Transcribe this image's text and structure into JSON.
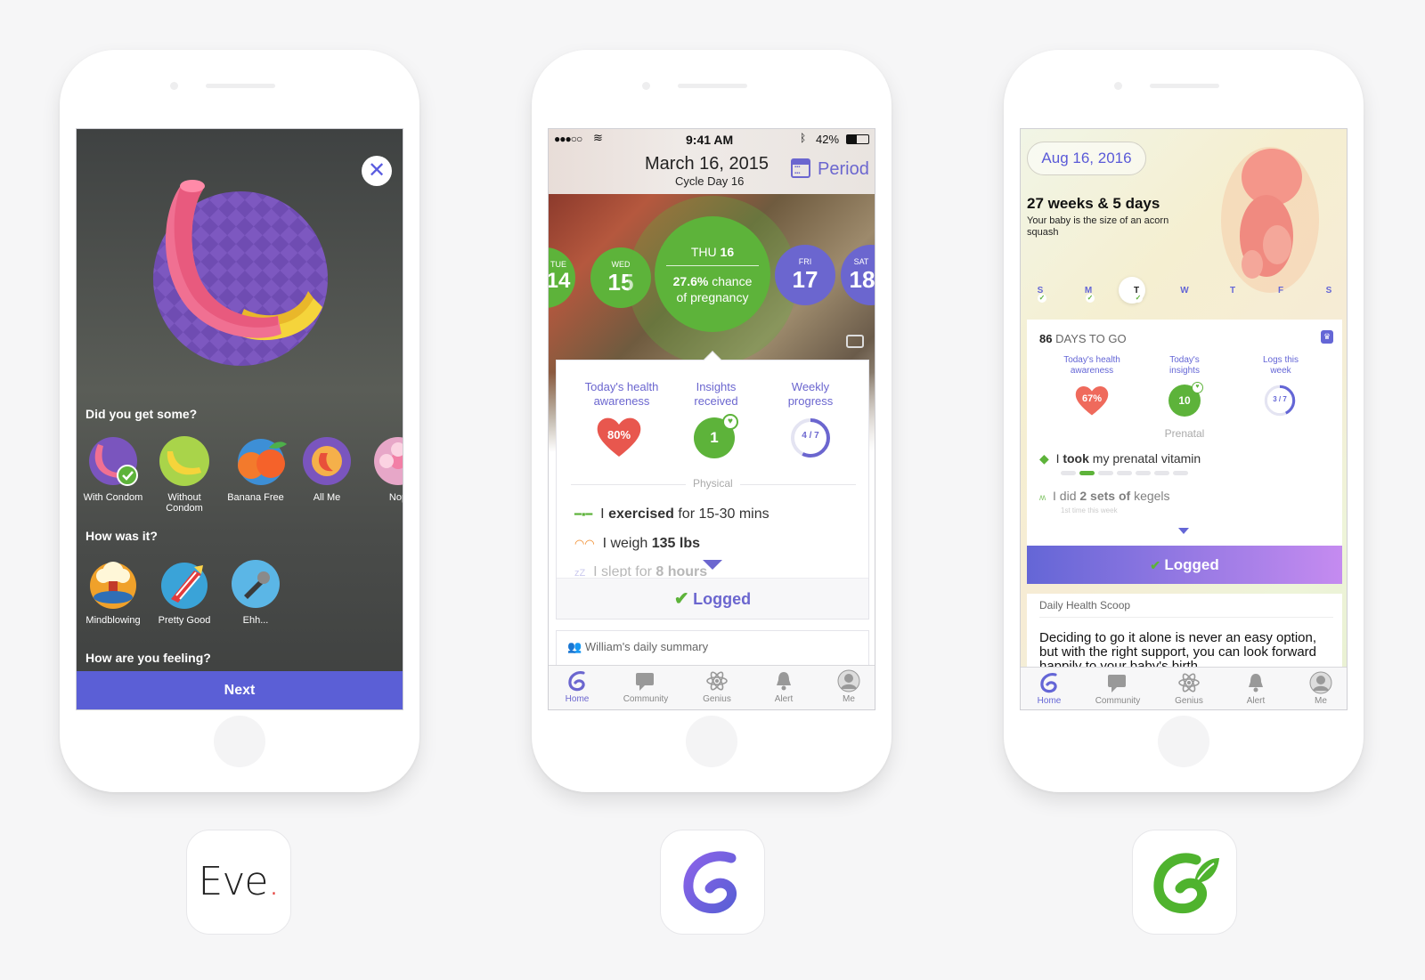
{
  "eve": {
    "q1": "Did you get some?",
    "q1_options": [
      {
        "label": "With Condom"
      },
      {
        "label": "Without Condom"
      },
      {
        "label": "Banana Free"
      },
      {
        "label": "All Me"
      },
      {
        "label": "Nop"
      }
    ],
    "q2": "How was it?",
    "q2_options": [
      {
        "label": "Mindblowing"
      },
      {
        "label": "Pretty Good"
      },
      {
        "label": "Ehh..."
      }
    ],
    "q3": "How are you feeling?",
    "next_label": "Next",
    "app_name": "Eve",
    "app_dot": ".",
    "colors": {
      "accent": "#5b5fd6",
      "dot": "#e4423e"
    }
  },
  "glow": {
    "status": {
      "carrier": "●●●○○",
      "time": "9:41 AM",
      "battery": "42%"
    },
    "date": "March 16, 2015",
    "cycle": "Cycle Day 16",
    "period_label": "Period",
    "days": [
      {
        "dow": "TUE",
        "num": "14"
      },
      {
        "dow": "WED",
        "num": "15"
      },
      {
        "dow": "THU",
        "num": "16"
      },
      {
        "dow": "FRI",
        "num": "17"
      },
      {
        "dow": "SAT",
        "num": "18"
      }
    ],
    "today_dow_prefix": "THU",
    "chance_pct": "27.6%",
    "chance_text": "chance",
    "chance_line2": "of pregnancy",
    "metrics": [
      {
        "label1": "Today's health",
        "label2": "awareness",
        "value": "80%"
      },
      {
        "label1": "Insights",
        "label2": "received",
        "value": "1"
      },
      {
        "label1": "Weekly",
        "label2": "progress",
        "value": "4 / 7",
        "fraction": 0.571
      }
    ],
    "section": "Physical",
    "logs": [
      {
        "pre": "I",
        "bold": "exercised",
        "post": "for 15-30 mins"
      },
      {
        "pre": "I weigh",
        "bold": "135 lbs",
        "post": ""
      },
      {
        "pre": "I slept for",
        "bold": "8 hours",
        "post": ""
      }
    ],
    "logged_label": "Logged",
    "summary": "William's daily summary",
    "tabs": [
      "Home",
      "Community",
      "Genius",
      "Alert",
      "Me"
    ],
    "colors": {
      "primary": "#6b66cf",
      "green": "#5db33a",
      "red": "#e8574e"
    }
  },
  "nurture": {
    "date": "Aug 16, 2016",
    "weeks": "27 weeks & 5 days",
    "baby_size": "Your baby is the size of an acorn squash",
    "week_days": [
      "S",
      "M",
      "T",
      "W",
      "T",
      "F",
      "S"
    ],
    "days_to_go_num": "86",
    "days_to_go_text": "DAYS TO GO",
    "metrics": [
      {
        "label1": "Today's health",
        "label2": "awareness",
        "value": "67%"
      },
      {
        "label1": "Today's",
        "label2": "insights",
        "value": "10"
      },
      {
        "label1": "Logs this",
        "label2": "week",
        "value": "3 / 7",
        "fraction": 0.428
      }
    ],
    "section": "Prenatal",
    "logs": [
      {
        "pre": "I",
        "bold": "took",
        "post": "my prenatal vitamin",
        "sub": ""
      },
      {
        "pre": "I did",
        "bold": "2 sets of",
        "post": "kegels",
        "sub": "1st time this week"
      }
    ],
    "logged_label": "Logged",
    "scoop_title": "Daily Health Scoop",
    "scoop_text": "Deciding to go it alone is never an easy option, but with the right support, you can look forward happily to your baby's birth.",
    "tabs": [
      "Home",
      "Community",
      "Genius",
      "Alert",
      "Me"
    ],
    "colors": {
      "primary": "#6466d6",
      "green": "#5db33a",
      "gradient_end": "#c58bf0"
    }
  }
}
